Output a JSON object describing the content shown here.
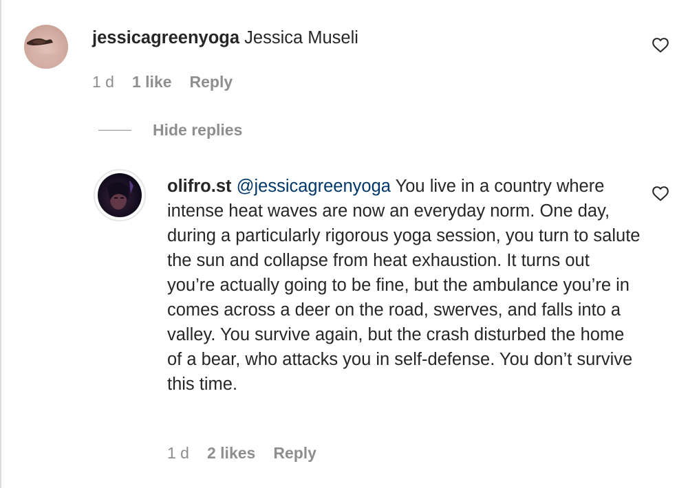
{
  "comments": [
    {
      "username": "jessicagreenyoga",
      "text": " Jessica Museli",
      "time": "1 d",
      "likes": "1 like",
      "reply_label": "Reply",
      "like_icon": "heart-outline-icon"
    }
  ],
  "replies_toggle": {
    "label": "Hide replies"
  },
  "replies": [
    {
      "username": "olifro.st",
      "mention": "@jessicagreenyoga",
      "text": " You live in a country where intense heat waves are now an everyday norm. One day, during a particularly rigorous yoga session, you turn to salute the sun and collapse from heat exhaustion. It turns out you’re actually going to be fine, but the ambulance you’re in comes across a deer on the road, swerves, and falls into a valley. You survive again, but the crash disturbed the home of a bear, who attacks you in self-defense. You don’t survive this time.",
      "time": "1 d",
      "likes": "2 likes",
      "reply_label": "Reply",
      "like_icon": "heart-outline-icon"
    }
  ],
  "colors": {
    "text": "#262626",
    "secondary": "#8e8e8e",
    "mention": "#00376b",
    "border": "#dbdbdb"
  }
}
